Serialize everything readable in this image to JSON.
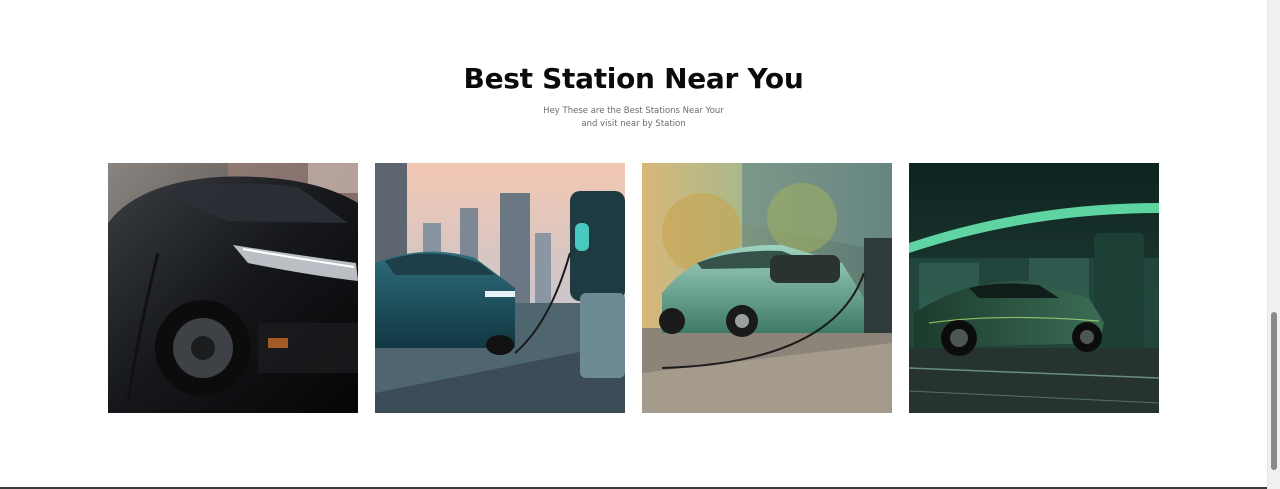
{
  "section": {
    "title": "Best Station Near You",
    "subtitle_line1": "Hey These are the Best Stations Near Your",
    "subtitle_line2": "and visit near by Station"
  },
  "gallery": {
    "images": [
      {
        "description": "black-ev-charging-closeup"
      },
      {
        "description": "teal-ev-city-charger"
      },
      {
        "description": "green-ev-street-charger"
      },
      {
        "description": "green-ev-neon-station"
      }
    ]
  },
  "colors": {
    "title": "#0b0b0b",
    "subtitle": "#6b6b6b",
    "background": "#ffffff"
  }
}
